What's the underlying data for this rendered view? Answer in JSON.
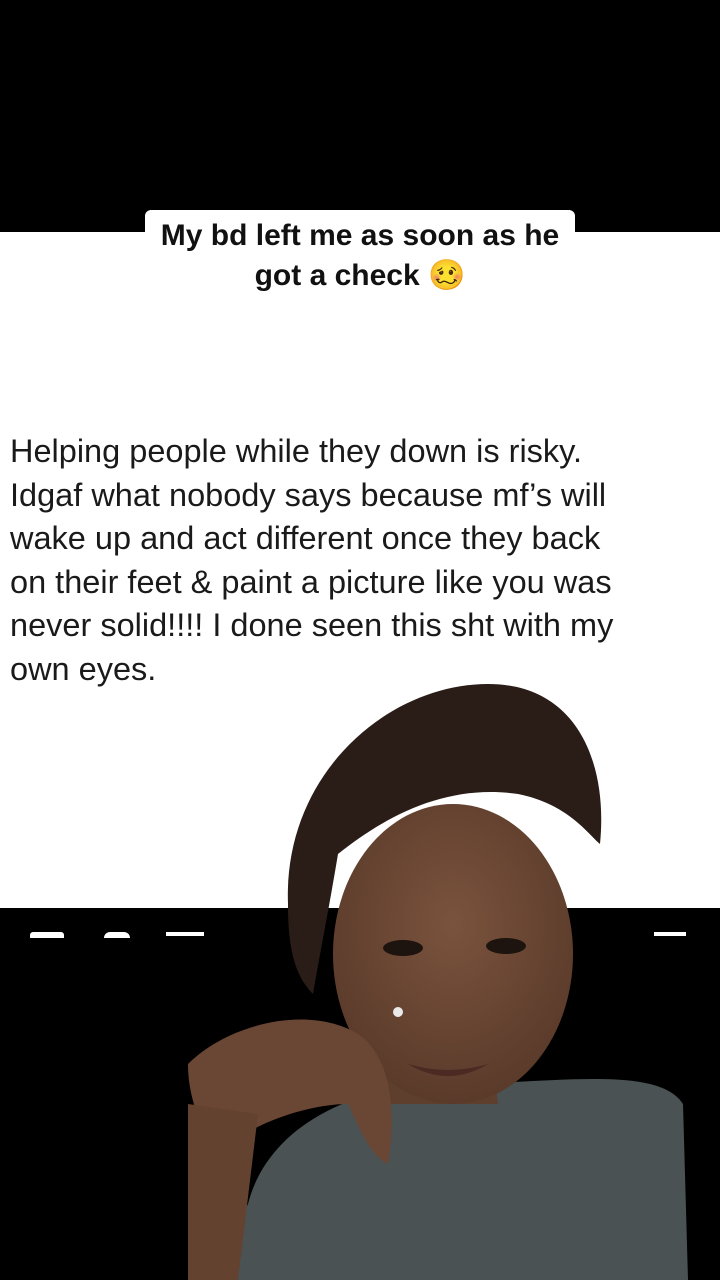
{
  "caption": {
    "line1": "My bd left me as soon as he",
    "line2": "got a check",
    "emoji": "🥴"
  },
  "tweet": {
    "lines": [
      "Helping people while they down is risky.",
      "Idgaf what nobody says because mf’s will",
      "wake up and act different once they back",
      "on their feet & paint a picture like you was",
      "never solid!!!! I done seen this sht with my",
      "own eyes."
    ]
  },
  "actions": [
    "reply-icon",
    "retweet-icon",
    "like-icon",
    "share-icon"
  ],
  "colors": {
    "background": "#000000",
    "card": "#ffffff",
    "text": "#1a1a1a",
    "skin": "#6e4a36",
    "hair": "#2a1d18",
    "shirt": "#4d5456"
  }
}
